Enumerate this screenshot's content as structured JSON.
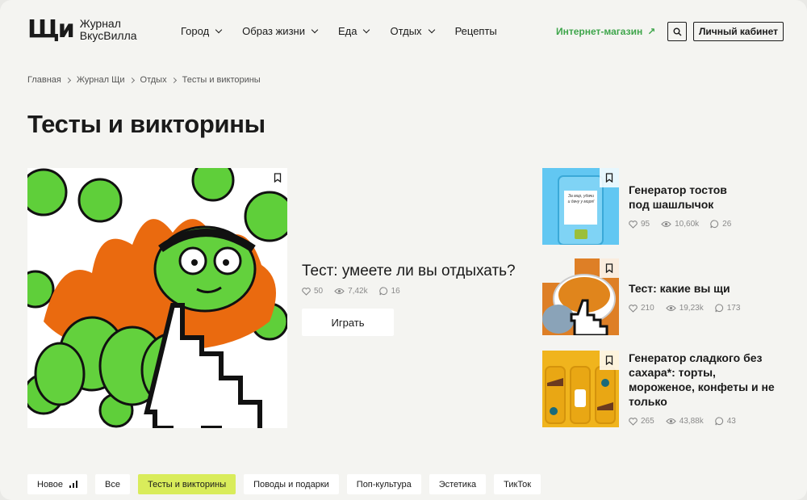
{
  "header": {
    "logo_mark": "Щи",
    "logo_line1": "Журнал",
    "logo_line2": "ВкусВилла",
    "nav": [
      {
        "label": "Город"
      },
      {
        "label": "Образ жизни"
      },
      {
        "label": "Еда"
      },
      {
        "label": "Отдых"
      },
      {
        "label": "Рецепты"
      }
    ],
    "shop_link": "Интернет-магазин",
    "account_button": "Личный кабинет"
  },
  "breadcrumb": [
    "Главная",
    "Журнал Щи",
    "Отдых",
    "Тесты и викторины"
  ],
  "page_title": "Тесты и викторины",
  "featured": {
    "title": "Тест: умеете ли вы отдыхать?",
    "likes": "50",
    "views": "7,42k",
    "comments": "16",
    "button": "Играть"
  },
  "side_items": [
    {
      "title": "Генератор тостов под шашлычок",
      "likes": "95",
      "views": "10,60k",
      "comments": "26",
      "thumb_text": "За мир, удачи и дачу у моря!"
    },
    {
      "title": "Тест: какие вы щи",
      "likes": "210",
      "views": "19,23k",
      "comments": "173"
    },
    {
      "title": "Генератор сладкого без сахара*: торты, мороженое, конфеты и не только",
      "likes": "265",
      "views": "43,88k",
      "comments": "43"
    }
  ],
  "chips": [
    {
      "label": "Новое"
    },
    {
      "label": "Все"
    },
    {
      "label": "Тесты и викторины",
      "active": true
    },
    {
      "label": "Поводы и подарки"
    },
    {
      "label": "Поп-культура"
    },
    {
      "label": "Эстетика"
    },
    {
      "label": "ТикТок"
    }
  ],
  "colors": {
    "accent_green": "#3ea54b",
    "chip_active": "#d9ec5b",
    "background": "#f4f4f1"
  }
}
